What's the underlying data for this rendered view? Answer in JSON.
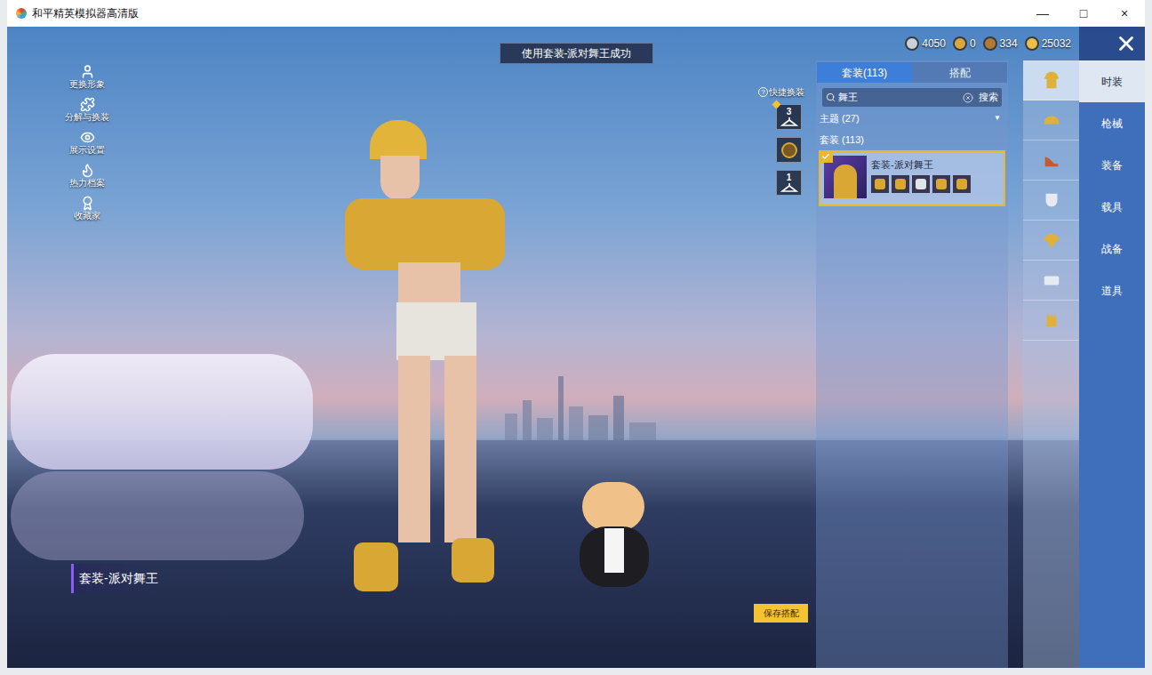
{
  "window": {
    "title": "和平精英模拟器高清版",
    "controls": [
      {
        "label": "—"
      },
      {
        "label": "□"
      },
      {
        "label": "×"
      }
    ]
  },
  "toast": "使用套装-派对舞王成功",
  "currencies": [
    {
      "value": "4050",
      "color": "#c9d1dc"
    },
    {
      "value": "0",
      "color": "#d9a640"
    },
    {
      "value": "334",
      "color": "#b07a3a"
    },
    {
      "value": "25032",
      "color": "#e8c04a"
    }
  ],
  "left_menu": [
    {
      "label": "更换形象"
    },
    {
      "label": "分解与换装"
    },
    {
      "label": "展示设置"
    },
    {
      "label": "热力档案"
    },
    {
      "label": "收藏家"
    }
  ],
  "quick_change": {
    "label": "快捷换装",
    "help": "?",
    "slots": [
      {
        "badge": "3",
        "locked": false,
        "marked": true
      },
      {
        "badge": "",
        "locked": true,
        "marked": false
      },
      {
        "badge": "1",
        "locked": false,
        "marked": false
      }
    ]
  },
  "panel": {
    "tabs": [
      {
        "label": "套装(113)",
        "selected": true
      },
      {
        "label": "搭配",
        "selected": false
      }
    ],
    "search": {
      "value": "舞王",
      "button": "搜索"
    },
    "filter": {
      "label": "主题 (27)",
      "arrow": "▼"
    },
    "section": "套装 (113)",
    "items": [
      {
        "name": "套装-派对舞王",
        "selected": true,
        "equipped": true
      }
    ]
  },
  "icon_column": [
    {
      "selected": true
    },
    {
      "selected": false
    },
    {
      "selected": false
    },
    {
      "selected": false
    },
    {
      "selected": false
    },
    {
      "selected": false
    },
    {
      "selected": false
    }
  ],
  "categories": [
    {
      "label": "时装",
      "selected": true
    },
    {
      "label": "枪械",
      "selected": false
    },
    {
      "label": "装备",
      "selected": false
    },
    {
      "label": "载具",
      "selected": false
    },
    {
      "label": "战备",
      "selected": false
    },
    {
      "label": "道具",
      "selected": false
    }
  ],
  "outfit_label": {
    "name": "套装-派对舞王"
  },
  "save_button": "保存搭配"
}
